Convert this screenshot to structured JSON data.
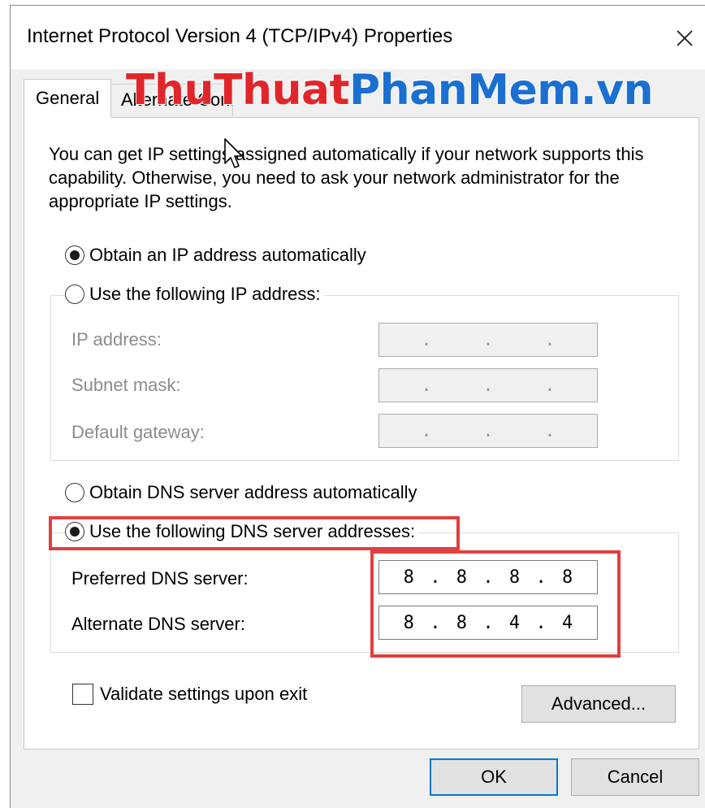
{
  "window": {
    "title": "Internet Protocol Version 4 (TCP/IPv4) Properties",
    "close_icon": "close-icon"
  },
  "tabs": [
    {
      "label": "General",
      "active": true
    },
    {
      "label": "Alternate Configuration",
      "active": false
    }
  ],
  "watermark": {
    "part1": "ThuThuat",
    "part2": "PhanMem.vn",
    "color1": "#e1262b",
    "color2": "#1a6fd0"
  },
  "intro_text": "You can get IP settings assigned automatically if your network supports this capability. Otherwise, you need to ask your network administrator for the appropriate IP settings.",
  "ip_section": {
    "obtain_auto_label": "Obtain an IP address automatically",
    "obtain_auto_selected": true,
    "use_following_label": "Use the following IP address:",
    "use_following_selected": false,
    "fields": [
      {
        "label": "IP address:",
        "separator": "."
      },
      {
        "label": "Subnet mask:",
        "separator": "."
      },
      {
        "label": "Default gateway:",
        "separator": "."
      }
    ]
  },
  "dns_section": {
    "obtain_auto_label": "Obtain DNS server address automatically",
    "obtain_auto_selected": false,
    "use_following_label": "Use the following DNS server addresses:",
    "use_following_selected": true,
    "preferred_label": "Preferred DNS server:",
    "preferred_octets": [
      "8",
      "8",
      "8",
      "8"
    ],
    "alternate_label": "Alternate DNS server:",
    "alternate_octets": [
      "8",
      "8",
      "4",
      "4"
    ],
    "separator": "."
  },
  "validate_label": "Validate settings upon exit",
  "validate_checked": false,
  "buttons": {
    "advanced": "Advanced...",
    "ok": "OK",
    "cancel": "Cancel"
  },
  "colors": {
    "highlight": "#e0403f",
    "accent": "#0078d7"
  }
}
